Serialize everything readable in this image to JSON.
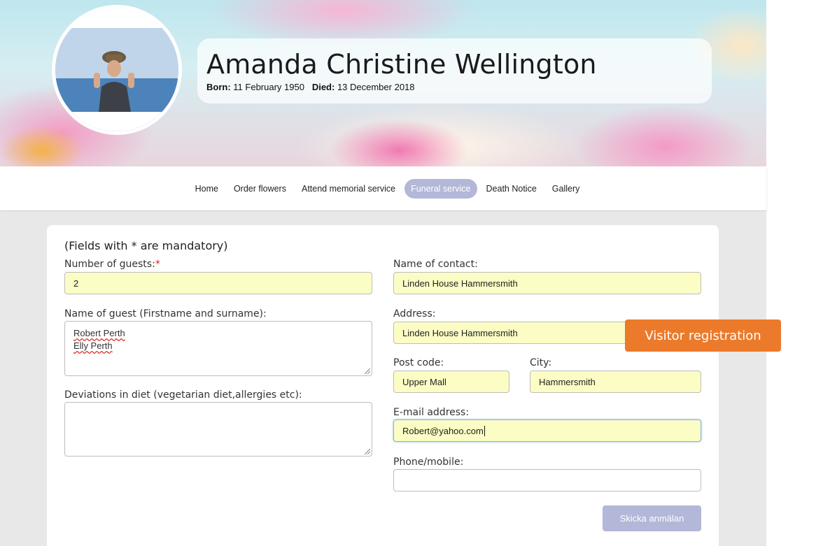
{
  "profile": {
    "name": "Amanda Christine Wellington",
    "born_label": "Born:",
    "born_value": "11 February 1950",
    "died_label": "Died:",
    "died_value": "13 December 2018",
    "photo_icon": "portrait-photo"
  },
  "nav": {
    "items": [
      {
        "label": "Home",
        "active": false
      },
      {
        "label": "Order flowers",
        "active": false
      },
      {
        "label": "Attend memorial service",
        "active": false
      },
      {
        "label": "Funeral service",
        "active": true
      },
      {
        "label": "Death Notice",
        "active": false
      },
      {
        "label": "Gallery",
        "active": false
      }
    ],
    "active_color": "#b3b7d8"
  },
  "form": {
    "mandatory_note": "(Fields with * are mandatory)",
    "guests_count": {
      "label": "Number of guests:",
      "required_mark": "*",
      "value": "2"
    },
    "guest_names": {
      "label": "Name of guest (Firstname and surname):",
      "lines": [
        "Robert Perth",
        "Elly Perth"
      ]
    },
    "diet": {
      "label": "Deviations in diet (vegetarian diet,allergies etc):",
      "value": ""
    },
    "contact_name": {
      "label": "Name of contact:",
      "value": "Linden House Hammersmith"
    },
    "address": {
      "label": "Address:",
      "value": "Linden House Hammersmith"
    },
    "post_code": {
      "label": "Post code:",
      "value": "Upper Mall"
    },
    "city": {
      "label": "City:",
      "value": "Hammersmith"
    },
    "email": {
      "label": "E-mail address:",
      "value": "Robert@yahoo.com"
    },
    "phone": {
      "label": "Phone/mobile:",
      "value": ""
    },
    "submit_label": "Skicka anmälan",
    "autofill_color": "#fbfdc4"
  },
  "overlay_badge": {
    "label": "Visitor registration",
    "color": "#ec7a2b"
  }
}
